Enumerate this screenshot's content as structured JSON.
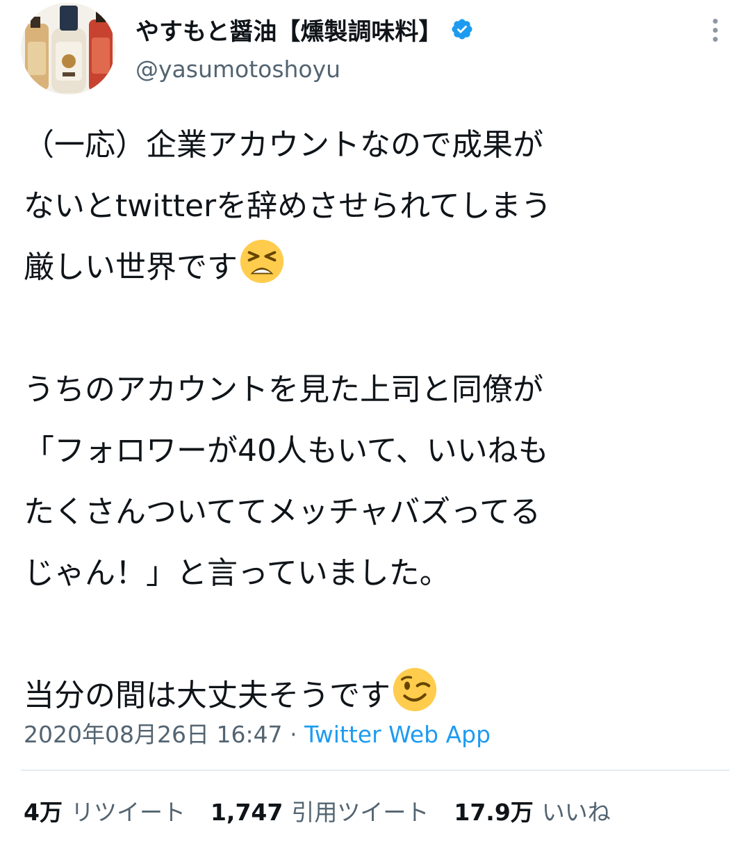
{
  "user": {
    "display_name": "やすもと醤油【燻製調味料】",
    "handle": "@yasumotoshoyu",
    "verified": true,
    "avatar_icon": "avatar-image"
  },
  "tweet": {
    "lines": [
      "（一応）企業アカウントなので成果が",
      "ないとtwitterを辞めさせられてしまう",
      "厳しい世界です",
      "",
      "うちのアカウントを見た上司と同僚が",
      "「フォロワーが40人もいて、いいねも",
      "たくさんついててメッチャバズってる",
      "じゃん！」と言っていました。",
      "",
      "当分の間は大丈夫そうです"
    ],
    "emoji_1": "tired-face-emoji",
    "emoji_2": "winking-face-emoji"
  },
  "meta": {
    "timestamp": "2020年08月26日 16:47",
    "separator": "·",
    "source": "Twitter Web App"
  },
  "stats": {
    "retweets_count": "4万",
    "retweets_label": "リツイート",
    "quotes_count": "1,747",
    "quotes_label": "引用ツイート",
    "likes_count": "17.9万",
    "likes_label": "いいね"
  },
  "colors": {
    "text": "#0f1419",
    "secondary": "#536471",
    "link": "#1d9bf0",
    "verified": "#1d9bf0",
    "divider": "#e6ecf0"
  }
}
